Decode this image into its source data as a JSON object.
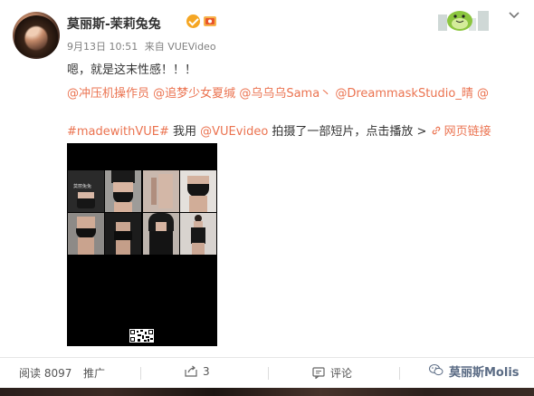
{
  "post": {
    "username": "莫丽斯-茉莉兔兔",
    "date": "9月13日 10:51",
    "source": "来自 VUEVideo",
    "text_line1": "嗯，就是这末性感！！！",
    "mentions": [
      "@冲压机操作员",
      "@追梦少女夏缄",
      "@乌乌乌Sama丶",
      "@DreammaskStudio_晴",
      "@"
    ],
    "hashtag": "#madewithVUE#",
    "text_mid": " 我用 ",
    "vue_mention": "@VUEvideo",
    "text_tail": " 拍摄了一部短片，点击播放 >",
    "web_link": "网页链接"
  },
  "video": {
    "brand": "莫丽兔兔",
    "watermark": "莫丽兔兔"
  },
  "footer": {
    "read_label": "阅读 8097",
    "promote_label": "推广",
    "share_count": "3",
    "comment_label": "评论",
    "wechat_watermark": "莫丽斯Molis"
  },
  "colors": {
    "link": "#eb7350",
    "verified": "#f5a623",
    "text": "#333333",
    "meta": "#808080"
  },
  "icons": [
    "verified-icon",
    "vip-badge-icon",
    "dino-mascot-icon",
    "chevron-down-icon",
    "link-icon",
    "share-icon",
    "comment-icon",
    "wechat-icon"
  ]
}
